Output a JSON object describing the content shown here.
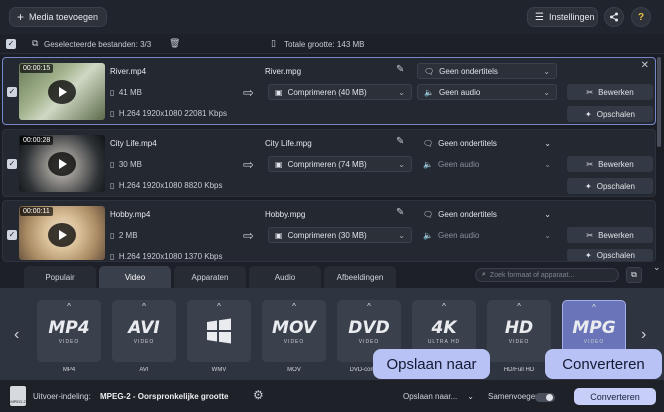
{
  "toolbar": {
    "add_media": "Media toevoegen",
    "settings": "Instellingen"
  },
  "selection": {
    "selected_files": "Geselecteerde bestanden: 3/3",
    "total_size": "Totale grootte: 143 MB"
  },
  "files": [
    {
      "duration": "00:00:15",
      "name": "River.mp4",
      "size": "41 MB",
      "specs": "H.264 1920x1080 22081 Kbps",
      "output_name": "River.mpg",
      "compress": "Comprimeren (40 MB)",
      "subtitles": "Geen ondertitels",
      "audio": "Geen audio",
      "edit": "Bewerken",
      "scale": "Opschalen"
    },
    {
      "duration": "00:00:28",
      "name": "City Life.mp4",
      "size": "30 MB",
      "specs": "H.264 1920x1080 8820 Kbps",
      "output_name": "City Life.mpg",
      "compress": "Comprimeren (74 MB)",
      "subtitles": "Geen ondertitels",
      "audio": "Geen audio",
      "edit": "Bewerken",
      "scale": "Opschalen"
    },
    {
      "duration": "00:00:11",
      "name": "Hobby.mp4",
      "size": "2 MB",
      "specs": "H.264 1920x1080 1370 Kbps",
      "output_name": "Hobby.mpg",
      "compress": "Comprimeren (30 MB)",
      "subtitles": "Geen ondertitels",
      "audio": "Geen audio",
      "edit": "Bewerken",
      "scale": "Opschalen"
    }
  ],
  "tabs": [
    "Populair",
    "Video",
    "Apparaten",
    "Audio",
    "Afbeeldingen"
  ],
  "search_placeholder": "Zoek formaat of apparaat...",
  "formats": [
    {
      "logo": "MP4",
      "sub": "VIDEO",
      "label": "MP4"
    },
    {
      "logo": "AVI",
      "sub": "VIDEO",
      "label": "AVI"
    },
    {
      "logo": "",
      "sub": "",
      "label": "WMV"
    },
    {
      "logo": "MOV",
      "sub": "VIDEO",
      "label": "MOV"
    },
    {
      "logo": "DVD",
      "sub": "VIDEO",
      "label": "DVD-compatib"
    },
    {
      "logo": "4K",
      "sub": "ULTRA HD",
      "label": ""
    },
    {
      "logo": "HD",
      "sub": "VIDEO",
      "label": "HD/Full HD"
    },
    {
      "logo": "MPG",
      "sub": "VIDEO",
      "label": ""
    }
  ],
  "bottom": {
    "output_format_label": "Uitvoer-indeling:",
    "output_format_value": "MPEG-2 - Oorspronkelijke grootte",
    "save_to": "Opslaan naar...",
    "merge": "Samenvoegen:",
    "convert": "Converteren",
    "logo_text": "MPEG-2"
  },
  "tooltips": {
    "save_to": "Opslaan naar",
    "convert": "Converteren"
  },
  "colors": {
    "accent": "#6975b8",
    "convert": "#c7cef8"
  }
}
